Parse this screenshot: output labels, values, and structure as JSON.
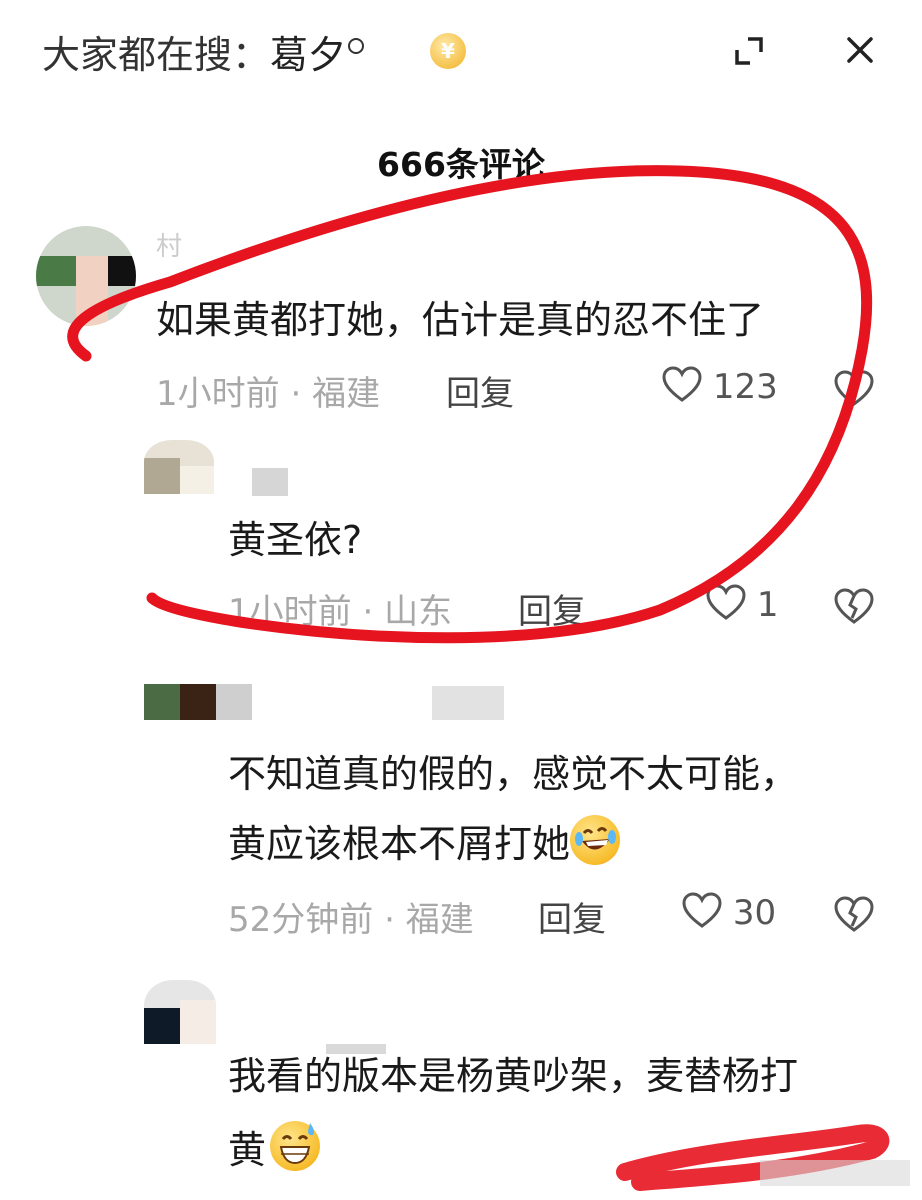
{
  "header": {
    "prefix": "大家都在搜：",
    "keyword": "葛夕",
    "coin_symbol": "¥",
    "icons": [
      "search-icon",
      "yuan-coin-icon",
      "expand-icon",
      "close-icon"
    ]
  },
  "comment_count": "666条评论",
  "comments": [
    {
      "username": "村",
      "text": "如果黄都打她，估计是真的忍不住了",
      "time": "1小时前",
      "location": "福建",
      "reply_label": "回复",
      "likes": "123"
    },
    {
      "text": "黄圣依?",
      "time": "1小时前",
      "location": "山东",
      "reply_label": "回复",
      "likes": "1"
    },
    {
      "text_line1": "不知道真的假的，感觉不太可能，",
      "text_line2": "黄应该根本不屑打她",
      "time": "52分钟前",
      "location": "福建",
      "reply_label": "回复",
      "likes": "30"
    },
    {
      "text_line1": "我看的版本是杨黄吵架，麦替杨打",
      "text_line2": "黄"
    }
  ],
  "meta_separator": " · ",
  "colors": {
    "annotation_red": "#e5141f",
    "meta_gray": "#a8a8a8"
  }
}
